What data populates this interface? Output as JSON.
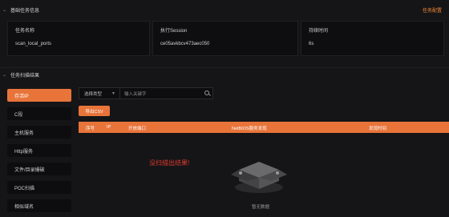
{
  "task_section": {
    "title": "基础任务信息",
    "link": "任务配置",
    "fields": [
      {
        "label": "任务名称",
        "value": "scan_local_ports"
      },
      {
        "label": "执行Session",
        "value": "ce05avkbcv473aec050"
      },
      {
        "label": "持续时间",
        "value": "6s"
      }
    ]
  },
  "result_section": {
    "title": "任务扫描结果"
  },
  "sidebar": {
    "items": [
      {
        "label": "存活IP",
        "active": true
      },
      {
        "label": "C段",
        "active": false
      },
      {
        "label": "主机服务",
        "active": false
      },
      {
        "label": "Http服务",
        "active": false
      },
      {
        "label": "文件/目录爆破",
        "active": false
      },
      {
        "label": "POC扫描",
        "active": false
      },
      {
        "label": "相似域名",
        "active": false
      }
    ]
  },
  "filter": {
    "select_label": "选择类型",
    "search_placeholder": "输入关键字"
  },
  "export_button": "导出CSV",
  "table": {
    "columns": [
      "序号",
      "IP",
      "开放端口",
      "NetBIOS服务发现",
      "发现时间"
    ]
  },
  "empty": {
    "overlay_text": "没扫描出结果!",
    "text": "暂无数据"
  },
  "colors": {
    "accent": "#e8743a",
    "background": "#151517",
    "error_text": "#e03a2e"
  },
  "icons": [
    "chevron-down-icon",
    "search-icon",
    "empty-box-icon"
  ]
}
